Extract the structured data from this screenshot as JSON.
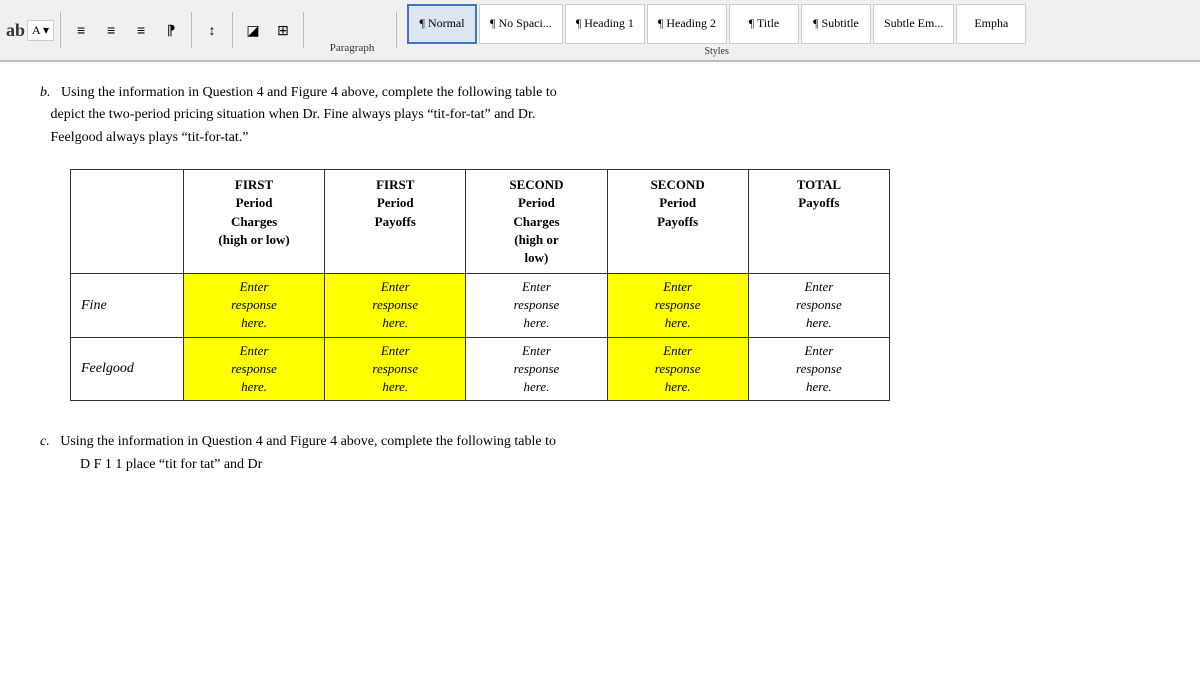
{
  "toolbar": {
    "paragraph_label": "Paragraph",
    "styles_label": "Styles",
    "style_items": [
      {
        "id": "normal",
        "label": "¶ Normal",
        "active": true
      },
      {
        "id": "no-spacing",
        "label": "¶ No Spaci..."
      },
      {
        "id": "heading1",
        "label": "¶ Heading 1"
      },
      {
        "id": "heading2",
        "label": "¶ Heading 2"
      },
      {
        "id": "title",
        "label": "¶ Title"
      },
      {
        "id": "subtitle",
        "label": "¶ Subtitle"
      },
      {
        "id": "subtle-em",
        "label": "Subtle Em..."
      },
      {
        "id": "empha",
        "label": "Empha"
      }
    ]
  },
  "document": {
    "question_b_label": "b.",
    "question_b_text": "Using the information in Question 4 and Figure 4 above, complete the following table to\n depict the two-period pricing situation when Dr. Fine always plays “tit-for-tat” and Dr.\n Feelgood always plays “tit-for-tat.”",
    "question_c_label": "c.",
    "question_c_text": "Using the information in Question 4 and Figure 4 above, complete the following table to",
    "question_c_text2": "D          F        1          1       place “tit for tat” and Dr",
    "table": {
      "headers": [
        "",
        "FIRST Period Charges (high or low)",
        "FIRST Period Payoffs",
        "SECOND Period Charges (high or low)",
        "SECOND Period Payoffs",
        "TOTAL Payoffs"
      ],
      "rows": [
        {
          "label": "Fine",
          "col1": "Enter response here.",
          "col2": "Enter response here.",
          "col3": "Enter response here.",
          "col4": "Enter response here.",
          "col5": "Enter response here.",
          "col1_yellow": true,
          "col2_yellow": true,
          "col3_yellow": false,
          "col4_yellow": true,
          "col5_yellow": false
        },
        {
          "label": "Feelgood",
          "col1": "Enter response here.",
          "col2": "Enter response here.",
          "col3": "Enter response here.",
          "col4": "Enter response here.",
          "col5": "Enter response here.",
          "col1_yellow": true,
          "col2_yellow": true,
          "col3_yellow": false,
          "col4_yellow": true,
          "col5_yellow": false
        }
      ]
    }
  }
}
